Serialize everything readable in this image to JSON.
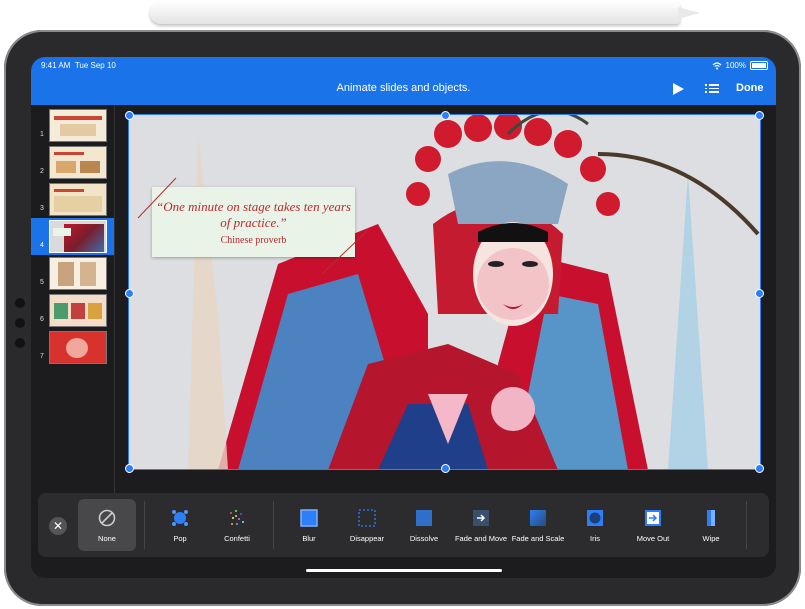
{
  "status_bar": {
    "time": "9:41 AM",
    "date": "Tue Sep 10",
    "battery": "100%"
  },
  "toolbar": {
    "title": "Animate slides and objects.",
    "done_label": "Done",
    "play_icon": "play-icon",
    "list_icon": "list-icon"
  },
  "navigator": {
    "slides": [
      {
        "number": "1",
        "selected": false
      },
      {
        "number": "2",
        "selected": false
      },
      {
        "number": "3",
        "selected": false
      },
      {
        "number": "4",
        "selected": true
      },
      {
        "number": "5",
        "selected": false
      },
      {
        "number": "6",
        "selected": false
      },
      {
        "number": "7",
        "selected": false
      }
    ]
  },
  "slide": {
    "quote": "“One minute on stage takes ten years of practice.”",
    "author": "Chinese proverb"
  },
  "animation_bar": {
    "close_icon": "close-icon",
    "items": [
      {
        "label": "None",
        "icon": "none-icon",
        "selected": true
      },
      {
        "label": "Pop",
        "icon": "pop-icon",
        "selected": false
      },
      {
        "label": "Confetti",
        "icon": "confetti-icon",
        "selected": false
      },
      {
        "label": "Blur",
        "icon": "blur-icon",
        "selected": false
      },
      {
        "label": "Disappear",
        "icon": "disappear-icon",
        "selected": false
      },
      {
        "label": "Dissolve",
        "icon": "dissolve-icon",
        "selected": false
      },
      {
        "label": "Fade and Move",
        "icon": "fade-and-move-icon",
        "selected": false
      },
      {
        "label": "Fade and Scale",
        "icon": "fade-and-scale-icon",
        "selected": false
      },
      {
        "label": "Iris",
        "icon": "iris-icon",
        "selected": false
      },
      {
        "label": "Move Out",
        "icon": "move-out-icon",
        "selected": false
      },
      {
        "label": "Wipe",
        "icon": "wipe-icon",
        "selected": false
      }
    ]
  },
  "colors": {
    "accent": "#1a73e8",
    "selection": "#2d7ff9",
    "quote_text": "#b52c2c",
    "quote_bg": "#e9f3e8"
  }
}
